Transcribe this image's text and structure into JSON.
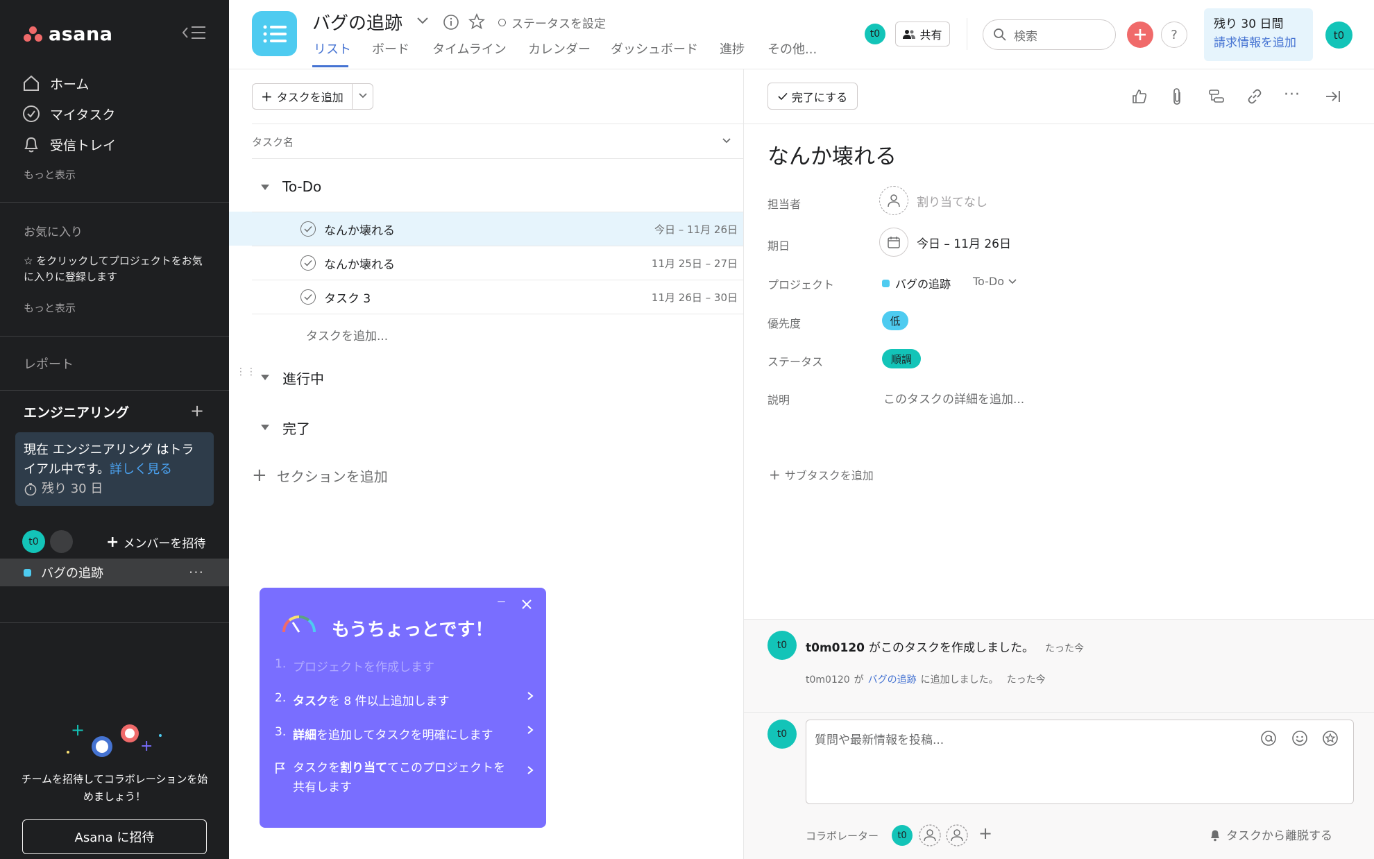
{
  "sidebar": {
    "logo_text": "asana",
    "nav": [
      {
        "label": "ホーム",
        "icon": "home-icon"
      },
      {
        "label": "マイタスク",
        "icon": "check-circle-icon"
      },
      {
        "label": "受信トレイ",
        "icon": "bell-icon"
      }
    ],
    "show_more_1": "もっと表示",
    "favorites_title": "お気に入り",
    "favorites_hint": "☆ をクリックしてプロジェクトをお気に入りに登録します",
    "show_more_2": "もっと表示",
    "reports": "レポート",
    "team_name": "エンジニアリング",
    "trial_text": "現在 エンジニアリング はトライアル中です。",
    "trial_link": "詳しく見る",
    "trial_remaining": "残り 30 日",
    "member_avatar": "t0",
    "invite_members": "メンバーを招待",
    "project_name": "バグの追跡",
    "invite_prompt": "チームを招待してコラボレーションを始めましょう！",
    "invite_button": "Asana に招待"
  },
  "header": {
    "project_title": "バグの追跡",
    "set_status": "ステータスを設定",
    "tabs": [
      "リスト",
      "ボード",
      "タイムライン",
      "カレンダー",
      "ダッシュボード",
      "進捗",
      "その他..."
    ],
    "active_tab": "リスト",
    "avatar": "t0",
    "share": "共有",
    "search_placeholder": "検索",
    "help": "?",
    "trial_days": "残り 30 日間",
    "billing_link": "請求情報を追加",
    "user_avatar": "t0"
  },
  "list": {
    "add_task": "タスクを追加",
    "column_task_name": "タスク名",
    "sections": [
      {
        "name": "To-Do"
      },
      {
        "name": "進行中"
      },
      {
        "name": "完了"
      }
    ],
    "tasks": [
      {
        "name": "なんか壊れる",
        "date": "今日 – 11月 26日"
      },
      {
        "name": "なんか壊れる",
        "date": "11月 25日 – 27日"
      },
      {
        "name": "タスク 3",
        "date": "11月 26日 – 30日"
      }
    ],
    "add_task_inline": "タスクを追加...",
    "add_section": "セクションを追加"
  },
  "onboarding": {
    "title": "もうちょっとです！",
    "items": [
      {
        "num": "1.",
        "text": "プロジェクトを作成します",
        "done": true
      },
      {
        "num": "2.",
        "bold": "タスク",
        "text": "を 8 件以上追加します"
      },
      {
        "num": "3.",
        "bold": "詳細",
        "text": "を追加してタスクを明確にします"
      },
      {
        "prefix": "タスクを",
        "bold": "割り当て",
        "text": "てこのプロジェクトを共有します"
      }
    ]
  },
  "detail": {
    "mark_complete": "完了にする",
    "task_title": "なんか壊れる",
    "labels": {
      "assignee": "担当者",
      "due": "期日",
      "project": "プロジェクト",
      "priority": "優先度",
      "status": "ステータス",
      "description": "説明"
    },
    "assignee_value": "割り当てなし",
    "due_value": "今日 – 11月 26日",
    "project_value": "バグの追跡",
    "project_section": "To-Do",
    "priority_value": "低",
    "status_value": "順調",
    "description_placeholder": "このタスクの詳細を追加...",
    "add_subtask": "サブタスクを追加",
    "feed": {
      "avatar": "t0",
      "created_user": "t0m0120",
      "created_text": "がこのタスクを作成しました。",
      "created_time": "たった今",
      "added_user": "t0m0120",
      "added_mid": "が",
      "added_project": "バグの追跡",
      "added_text": "に追加しました。",
      "added_time": "たった今"
    },
    "comment_placeholder": "質問や最新情報を投稿...",
    "collaborators_label": "コラボレーター",
    "collab_avatar": "t0",
    "leave_task": "タスクから離脱する"
  },
  "colors": {
    "sidebar_bg": "#1e1f21",
    "accent_blue": "#4573d2",
    "project_cyan": "#4ecbf0",
    "avatar_teal": "#13c4b8",
    "onboard_purple": "#796eff",
    "add_orange": "#f06a6a"
  }
}
